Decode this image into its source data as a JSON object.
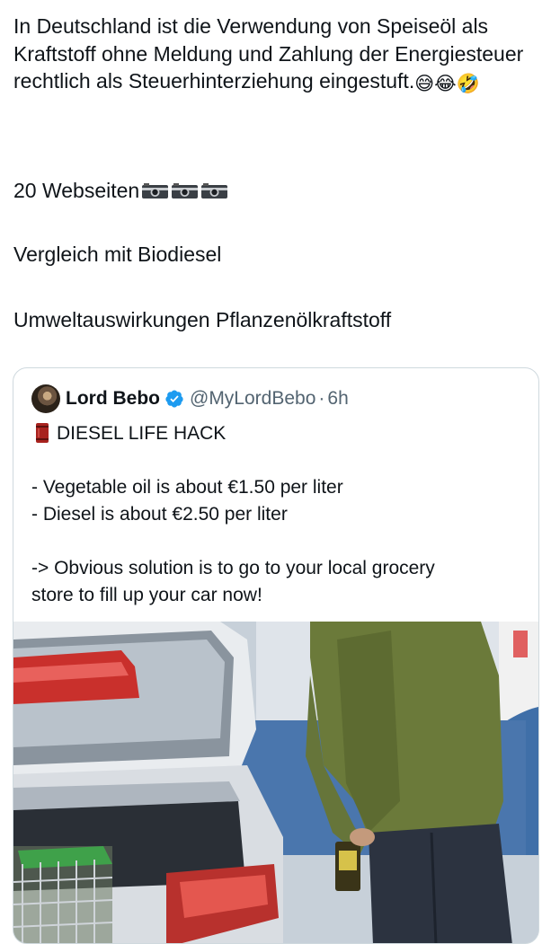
{
  "tweet": {
    "paragraph1": "In Deutschland ist die Verwendung von Speiseöl als Kraftstoff ohne Meldung und Zahlung der Energiesteuer rechtlich als Steuerhinterziehung eingestuft.",
    "paragraph1_emojis": [
      "😅",
      "😂",
      "🤣"
    ],
    "paragraph2": "20 Webseiten",
    "paragraph2_icons": [
      "camera-icon",
      "camera-icon",
      "camera-icon"
    ],
    "paragraph3": "Vergleich mit Biodiesel",
    "paragraph4": "Umweltauswirkungen Pflanzenölkraftstoff"
  },
  "quote": {
    "name": "Lord Bebo",
    "handle": "@MyLordBebo",
    "separator": "·",
    "time": "6h",
    "title": "DIESEL LIFE HACK",
    "title_icon": "oil-barrel-icon",
    "line1": "- Vegetable oil is about €1.50 per liter",
    "line2": "- Diesel is about €2.50 per liter",
    "line3": "-> Obvious solution is to go to your local grocery",
    "line4": "store to fill up your car now!",
    "verified_color": "#1d9bf0"
  }
}
